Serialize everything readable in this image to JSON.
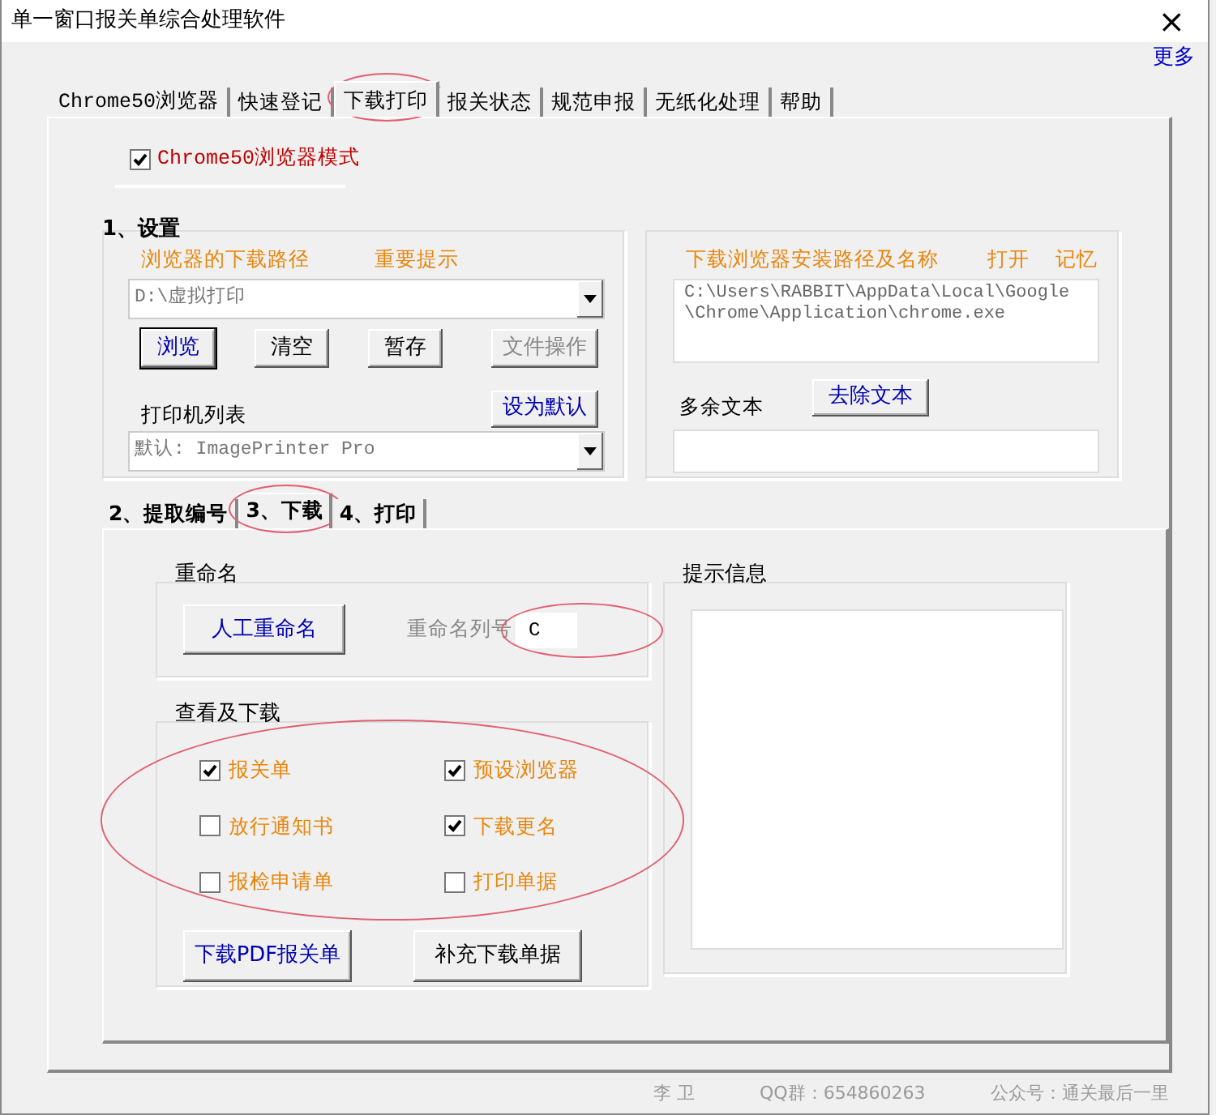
{
  "window": {
    "title": "单一窗口报关单综合处理软件",
    "close": "×"
  },
  "more_link": "更多",
  "tabs": [
    {
      "label": "Chrome50浏览器",
      "selected": false,
      "circled": false
    },
    {
      "label": "快速登记",
      "selected": false,
      "circled": false
    },
    {
      "label": "下载打印",
      "selected": true,
      "circled": true
    },
    {
      "label": "报关状态",
      "selected": false,
      "circled": false
    },
    {
      "label": "规范申报",
      "selected": false,
      "circled": false
    },
    {
      "label": "无纸化处理",
      "selected": false,
      "circled": false
    },
    {
      "label": "帮助",
      "selected": false,
      "circled": false
    }
  ],
  "mode_checkbox": {
    "label": "Chrome50浏览器模式",
    "checked": true
  },
  "settings": {
    "title": "1、设置",
    "left": {
      "labels": [
        "浏览器的下载路径",
        "重要提示"
      ],
      "path_combo": {
        "value": "D:\\虚拟打印"
      },
      "buttons": [
        {
          "label": "浏览",
          "default": true,
          "disabled": false
        },
        {
          "label": "清空",
          "default": false,
          "disabled": false
        },
        {
          "label": "暂存",
          "default": false,
          "disabled": false
        },
        {
          "label": "文件操作",
          "default": false,
          "disabled": true
        }
      ],
      "printer_label": "打印机列表",
      "set_default_button": "设为默认",
      "printer_combo": {
        "value": "默认: ImagePrinter Pro"
      }
    },
    "right": {
      "labels": [
        "下载浏览器安装路径及名称",
        "打开",
        "记忆"
      ],
      "path_box": {
        "value": "C:\\Users\\RABBIT\\AppData\\Local\\Google\\Chrome\\Application\\chrome.exe"
      },
      "remove_button": "去除文本",
      "extra_label": "多余文本"
    }
  },
  "subtabs": [
    {
      "label": "2、提取编号",
      "selected": false,
      "circled": false
    },
    {
      "label": "3、下载",
      "selected": true,
      "circled": true
    },
    {
      "label": "4、打印",
      "selected": false,
      "circled": false
    }
  ],
  "rename": {
    "title": "重命名",
    "button": "人工重命名",
    "column_label": "重命名列号",
    "column_value": "C",
    "circled": true
  },
  "download": {
    "title": "查看及下载",
    "circled": true,
    "checkboxes": [
      {
        "label": "报关单",
        "checked": true
      },
      {
        "label": "预设浏览器",
        "checked": true
      },
      {
        "label": "放行通知书",
        "checked": false
      },
      {
        "label": "下载更名",
        "checked": true
      },
      {
        "label": "报检申请单",
        "checked": false
      },
      {
        "label": "打印单据",
        "checked": false
      }
    ],
    "buttons": [
      {
        "label": "下载PDF报关单",
        "color": "#0000b0"
      },
      {
        "label": "补充下载单据",
        "color": "#000000"
      }
    ]
  },
  "info": {
    "title": "提示信息"
  },
  "footer": [
    "李 卫",
    "QQ群：654860263",
    "公众号：通关最后一里"
  ]
}
